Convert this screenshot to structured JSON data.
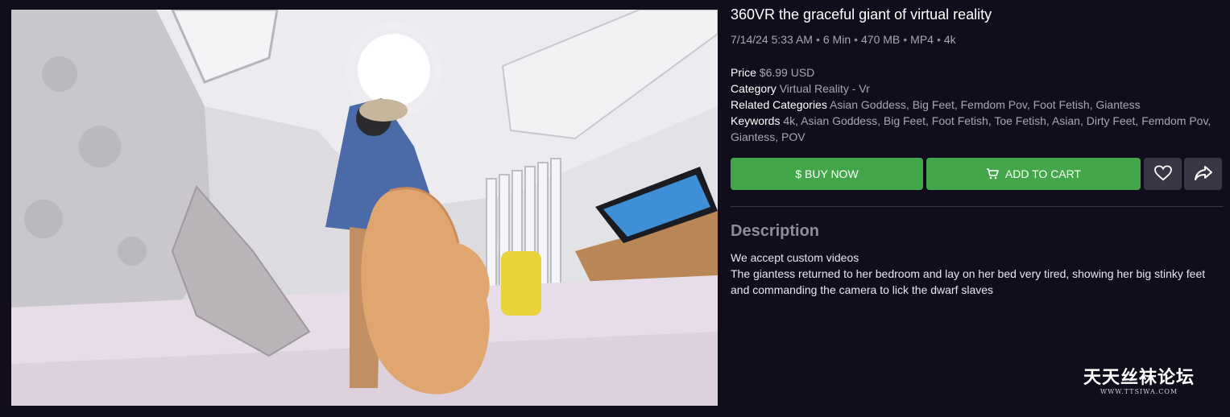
{
  "product": {
    "title": "360VR the graceful giant of virtual reality",
    "meta": {
      "date": "7/14/24 5:33 AM",
      "duration": "6 Min",
      "size": "470 MB",
      "format": "MP4",
      "quality": "4k",
      "separator": "•"
    },
    "details": {
      "price_label": "Price",
      "price_value": "$6.99 USD",
      "category_label": "Category",
      "category_value": "Virtual Reality - Vr",
      "related_label": "Related Categories",
      "related_value": "Asian Goddess, Big Feet, Femdom Pov, Foot Fetish, Giantess",
      "keywords_label": "Keywords",
      "keywords_value": "4k, Asian Goddess, Big Feet, Foot Fetish, Toe Fetish, Asian, Dirty Feet, Femdom Pov, Giantess, POV"
    }
  },
  "actions": {
    "buy_now": "$ BUY NOW",
    "add_to_cart": "ADD TO CART"
  },
  "description": {
    "heading": "Description",
    "line1": "We accept custom videos",
    "line2": "The giantess returned to her bedroom and lay on her bed very tired, showing her big stinky feet and commanding the camera to lick the dwarf slaves"
  },
  "watermark": {
    "main": "天天丝袜论坛",
    "sub": "WWW.TTSIWA.COM"
  },
  "icons": {
    "favorite": "heart-icon",
    "share": "share-icon",
    "cart": "cart-icon"
  },
  "colors": {
    "background": "#120d1c",
    "accent_green": "#43a648",
    "icon_button": "#3a3645",
    "muted_text": "#a9a6b3"
  }
}
